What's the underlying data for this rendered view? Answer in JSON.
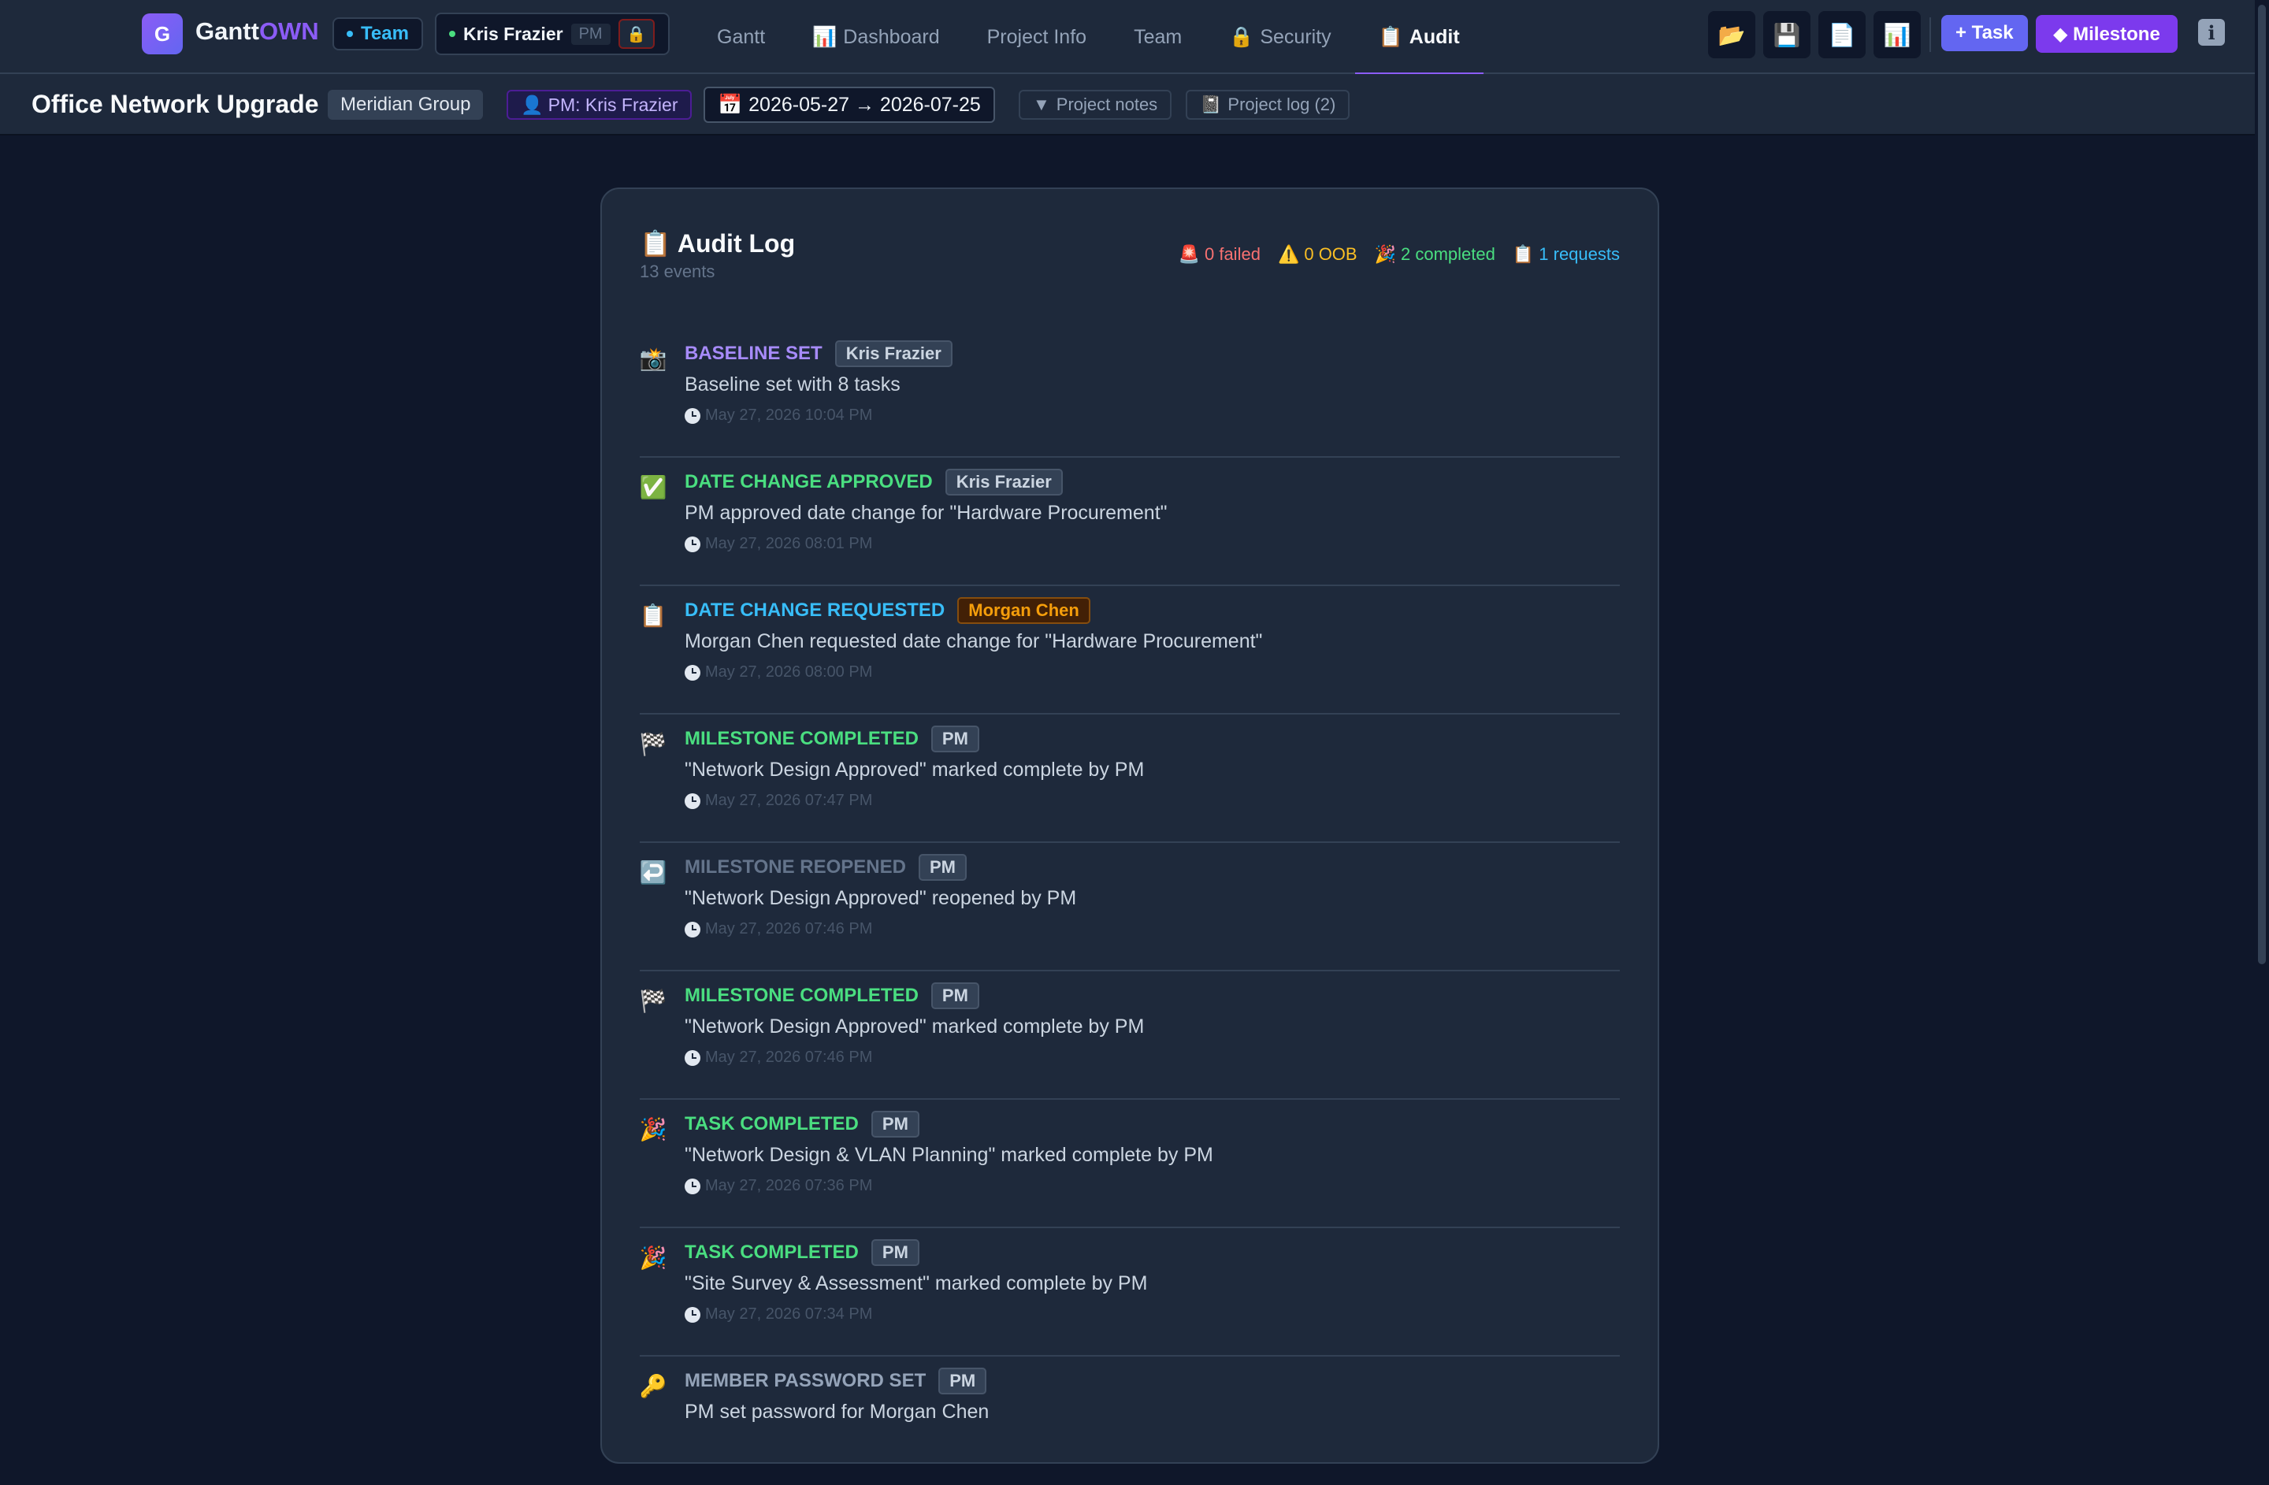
{
  "app": {
    "logo_letter": "G",
    "name_part1": "Gantt",
    "name_part2": "OWN"
  },
  "header": {
    "mode_label": "Team",
    "user_name": "Kris Frazier",
    "user_role": "PM",
    "tabs": [
      {
        "label": "Gantt",
        "icon": ""
      },
      {
        "label": "Dashboard",
        "icon": "📊"
      },
      {
        "label": "Project Info",
        "icon": ""
      },
      {
        "label": "Team",
        "icon": ""
      },
      {
        "label": "Security",
        "icon": "🔒"
      },
      {
        "label": "Audit",
        "icon": "📋"
      }
    ],
    "active_tab": "Audit",
    "tools": [
      {
        "name": "open-folder-icon",
        "glyph": "📂"
      },
      {
        "name": "save-icon",
        "glyph": "💾"
      },
      {
        "name": "document-icon",
        "glyph": "📄"
      },
      {
        "name": "chart-icon",
        "glyph": "📊"
      }
    ],
    "add_task_label": "+ Task",
    "add_milestone_label": "◆ Milestone",
    "info_label": "i"
  },
  "project": {
    "title": "Office Network Upgrade",
    "client": "Meridian Group",
    "pm_label": "PM: Kris Frazier",
    "pm_icon": "👤",
    "date_icon": "📅",
    "date_range": "2026-05-27 → 2026-07-25",
    "notes_label": "Project notes",
    "notes_icon": "▼",
    "log_label": "Project log (2)",
    "log_icon": "📓"
  },
  "audit": {
    "title": "Audit Log",
    "title_icon": "📋",
    "count_label": "13 events",
    "stats": [
      {
        "icon": "🚨",
        "label": "0 failed",
        "color": "#f87171"
      },
      {
        "icon": "⚠️",
        "label": "0 OOB",
        "color": "#fbbf24"
      },
      {
        "icon": "🎉",
        "label": "2 completed",
        "color": "#4ade80"
      },
      {
        "icon": "📋",
        "label": "1 requests",
        "color": "#38bdf8"
      }
    ],
    "events": [
      {
        "icon": "📸",
        "type": "BASELINE SET",
        "type_color": "#a78bfa",
        "actor": "Kris Frazier",
        "actor_style": "",
        "desc": "Baseline set with 8 tasks",
        "time": "May 27, 2026 10:04 PM"
      },
      {
        "icon": "✅",
        "type": "DATE CHANGE APPROVED",
        "type_color": "#4ade80",
        "actor": "Kris Frazier",
        "actor_style": "",
        "desc": "PM approved date change for \"Hardware Procurement\"",
        "time": "May 27, 2026 08:01 PM"
      },
      {
        "icon": "📋",
        "type": "DATE CHANGE REQUESTED",
        "type_color": "#38bdf8",
        "actor": "Morgan Chen",
        "actor_style": "morgan",
        "desc": "Morgan Chen requested date change for \"Hardware Procurement\"",
        "time": "May 27, 2026 08:00 PM"
      },
      {
        "icon": "🏁",
        "type": "MILESTONE COMPLETED",
        "type_color": "#4ade80",
        "actor": "PM",
        "actor_style": "",
        "desc": "\"Network Design Approved\" marked complete by PM",
        "time": "May 27, 2026 07:47 PM"
      },
      {
        "icon": "↩️",
        "type": "MILESTONE REOPENED",
        "type_color": "#64748b",
        "actor": "PM",
        "actor_style": "",
        "desc": "\"Network Design Approved\" reopened by PM",
        "time": "May 27, 2026 07:46 PM"
      },
      {
        "icon": "🏁",
        "type": "MILESTONE COMPLETED",
        "type_color": "#4ade80",
        "actor": "PM",
        "actor_style": "",
        "desc": "\"Network Design Approved\" marked complete by PM",
        "time": "May 27, 2026 07:46 PM"
      },
      {
        "icon": "🎉",
        "type": "TASK COMPLETED",
        "type_color": "#4ade80",
        "actor": "PM",
        "actor_style": "",
        "desc": "\"Network Design & VLAN Planning\" marked complete by PM",
        "time": "May 27, 2026 07:36 PM"
      },
      {
        "icon": "🎉",
        "type": "TASK COMPLETED",
        "type_color": "#4ade80",
        "actor": "PM",
        "actor_style": "",
        "desc": "\"Site Survey & Assessment\" marked complete by PM",
        "time": "May 27, 2026 07:34 PM"
      },
      {
        "icon": "🔑",
        "type": "MEMBER PASSWORD SET",
        "type_color": "#94a3b8",
        "actor": "PM",
        "actor_style": "",
        "desc": "PM set password for Morgan Chen",
        "time": ""
      }
    ]
  },
  "colors": {
    "accent": "#8b5cf6",
    "background": "#0f172a",
    "panel": "#1e293b",
    "team_blue": "#38bdf8",
    "online_green": "#4ade80"
  }
}
